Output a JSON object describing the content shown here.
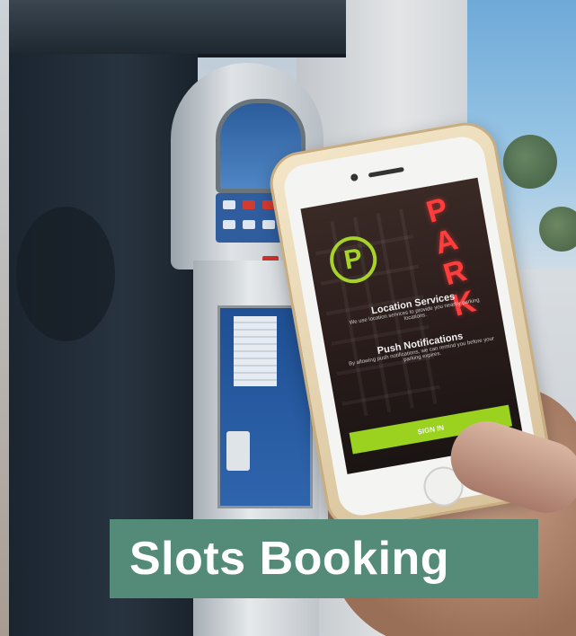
{
  "caption": {
    "title": "Slots Booking"
  },
  "phone_screen": {
    "logo_letter": "P",
    "sign_letters": [
      "P",
      "A",
      "R",
      "K"
    ],
    "heading_1": "Location Services",
    "sub_1": "We use location services to provide you nearby parking locations.",
    "heading_2": "Push Notifications",
    "sub_2": "By allowing push notifications, we can remind you before your parking expires.",
    "button_label": "SIGN IN"
  },
  "colors": {
    "caption_bg": "#548a78",
    "caption_text": "#ffffff",
    "logo_green": "#a7d22a",
    "sign_red": "#ff3d3d"
  }
}
